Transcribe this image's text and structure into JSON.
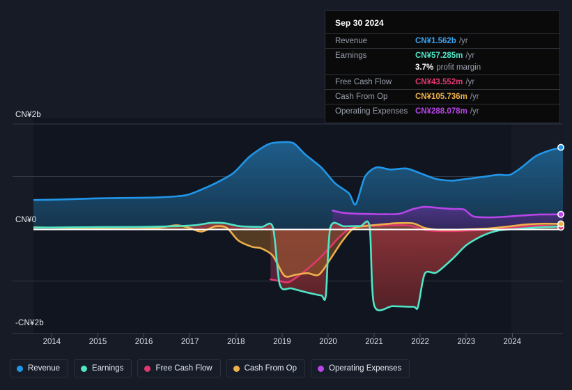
{
  "chart_data": {
    "type": "area",
    "title": "",
    "xlabel": "",
    "ylabel": "",
    "currency": "CN¥",
    "grid": true,
    "legend_position": "bottom",
    "ylim": [
      -2000,
      2000
    ],
    "y_ticks": [
      {
        "value": 2000,
        "label": "CN¥2b"
      },
      {
        "value": 0,
        "label": "CN¥0"
      },
      {
        "value": -2000,
        "label": "-CN¥2b"
      }
    ],
    "x_ticks": [
      "2014",
      "2015",
      "2016",
      "2017",
      "2018",
      "2019",
      "2020",
      "2021",
      "2022",
      "2023",
      "2024"
    ],
    "x_range": [
      2013.6,
      2025.1
    ],
    "forecast_start": "2023.8",
    "series": [
      {
        "name": "Revenue",
        "color": "#2196e8",
        "fill": "#1b4a6b",
        "points": [
          [
            2013.6,
            560
          ],
          [
            2014.2,
            570
          ],
          [
            2014.9,
            590
          ],
          [
            2015.6,
            600
          ],
          [
            2016.3,
            610
          ],
          [
            2016.9,
            650
          ],
          [
            2017.25,
            760
          ],
          [
            2017.6,
            900
          ],
          [
            2017.95,
            1080
          ],
          [
            2018.3,
            1390
          ],
          [
            2018.7,
            1620
          ],
          [
            2019.0,
            1660
          ],
          [
            2019.25,
            1640
          ],
          [
            2019.5,
            1430
          ],
          [
            2019.85,
            1180
          ],
          [
            2020.15,
            880
          ],
          [
            2020.45,
            690
          ],
          [
            2020.6,
            480
          ],
          [
            2020.8,
            1000
          ],
          [
            2021.05,
            1180
          ],
          [
            2021.35,
            1140
          ],
          [
            2021.7,
            1160
          ],
          [
            2022.0,
            1070
          ],
          [
            2022.35,
            960
          ],
          [
            2022.7,
            930
          ],
          [
            2023.0,
            960
          ],
          [
            2023.35,
            1000
          ],
          [
            2023.7,
            1040
          ],
          [
            2023.95,
            1040
          ],
          [
            2024.2,
            1180
          ],
          [
            2024.5,
            1390
          ],
          [
            2024.8,
            1500
          ],
          [
            2025.1,
            1562
          ]
        ],
        "end_value": 1562,
        "end_marker": true
      },
      {
        "name": "Earnings",
        "color": "#4fe6c8",
        "fill": "#7a2530",
        "points": [
          [
            2013.6,
            35
          ],
          [
            2014.4,
            40
          ],
          [
            2015.1,
            45
          ],
          [
            2015.9,
            48
          ],
          [
            2016.6,
            60
          ],
          [
            2017.1,
            80
          ],
          [
            2017.45,
            125
          ],
          [
            2017.75,
            120
          ],
          [
            2018.1,
            60
          ],
          [
            2018.55,
            48
          ],
          [
            2018.8,
            45
          ],
          [
            2018.95,
            -1050
          ],
          [
            2019.2,
            -1120
          ],
          [
            2019.55,
            -1200
          ],
          [
            2019.85,
            -1255
          ],
          [
            2019.95,
            -1260
          ],
          [
            2020.05,
            40
          ],
          [
            2020.35,
            60
          ],
          [
            2020.7,
            65
          ],
          [
            2020.9,
            60
          ],
          [
            2021.0,
            -1440
          ],
          [
            2021.4,
            -1460
          ],
          [
            2021.85,
            -1470
          ],
          [
            2021.95,
            -1475
          ],
          [
            2022.1,
            -840
          ],
          [
            2022.35,
            -820
          ],
          [
            2022.7,
            -560
          ],
          [
            2023.0,
            -300
          ],
          [
            2023.35,
            -120
          ],
          [
            2023.7,
            -20
          ],
          [
            2024.1,
            10
          ],
          [
            2024.6,
            40
          ],
          [
            2025.1,
            57.285
          ]
        ],
        "end_value": 57.285,
        "end_marker": true
      },
      {
        "name": "Free Cash Flow",
        "color": "#e0386e",
        "fill": "#8c3050",
        "points": [
          [
            2018.75,
            -950
          ],
          [
            2018.95,
            -980
          ],
          [
            2019.15,
            -1000
          ],
          [
            2019.45,
            -820
          ],
          [
            2019.75,
            -600
          ],
          [
            2020.0,
            -380
          ],
          [
            2020.25,
            -140
          ],
          [
            2020.5,
            30
          ],
          [
            2020.8,
            60
          ],
          [
            2021.1,
            70
          ],
          [
            2021.45,
            80
          ],
          [
            2021.8,
            70
          ],
          [
            2022.1,
            -10
          ],
          [
            2022.4,
            -30
          ],
          [
            2022.8,
            -30
          ],
          [
            2023.1,
            -20
          ],
          [
            2023.5,
            0
          ],
          [
            2023.9,
            25
          ],
          [
            2024.3,
            60
          ],
          [
            2024.7,
            70
          ],
          [
            2025.1,
            43.552
          ]
        ],
        "end_value": 43.552,
        "end_marker": true
      },
      {
        "name": "Cash From Op",
        "color": "#eeb04a",
        "fill": "#8a5a26",
        "points": [
          [
            2013.6,
            40
          ],
          [
            2014.4,
            30
          ],
          [
            2015.1,
            15
          ],
          [
            2015.8,
            10
          ],
          [
            2016.3,
            30
          ],
          [
            2016.7,
            80
          ],
          [
            2016.95,
            40
          ],
          [
            2017.25,
            -40
          ],
          [
            2017.55,
            60
          ],
          [
            2017.8,
            30
          ],
          [
            2018.05,
            -210
          ],
          [
            2018.35,
            -330
          ],
          [
            2018.55,
            -360
          ],
          [
            2018.8,
            -500
          ],
          [
            2019.05,
            -880
          ],
          [
            2019.3,
            -860
          ],
          [
            2019.55,
            -830
          ],
          [
            2019.8,
            -860
          ],
          [
            2020.05,
            -560
          ],
          [
            2020.3,
            -230
          ],
          [
            2020.55,
            20
          ],
          [
            2020.85,
            70
          ],
          [
            2021.15,
            95
          ],
          [
            2021.5,
            120
          ],
          [
            2021.85,
            115
          ],
          [
            2022.1,
            30
          ],
          [
            2022.4,
            -5
          ],
          [
            2022.8,
            -5
          ],
          [
            2023.1,
            5
          ],
          [
            2023.5,
            20
          ],
          [
            2023.9,
            55
          ],
          [
            2024.3,
            95
          ],
          [
            2024.7,
            110
          ],
          [
            2025.1,
            105.736
          ]
        ],
        "end_value": 105.736,
        "end_marker": true
      },
      {
        "name": "Operating Expenses",
        "color": "#b845e8",
        "fill": "#4a2a70",
        "points": [
          [
            2020.1,
            360
          ],
          [
            2020.3,
            320
          ],
          [
            2020.6,
            300
          ],
          [
            2020.9,
            295
          ],
          [
            2021.2,
            290
          ],
          [
            2021.55,
            300
          ],
          [
            2021.85,
            390
          ],
          [
            2022.1,
            430
          ],
          [
            2022.4,
            410
          ],
          [
            2022.7,
            390
          ],
          [
            2022.95,
            380
          ],
          [
            2023.15,
            250
          ],
          [
            2023.45,
            230
          ],
          [
            2023.8,
            240
          ],
          [
            2024.2,
            265
          ],
          [
            2024.6,
            285
          ],
          [
            2025.1,
            288.078
          ]
        ],
        "end_value": 288.078,
        "end_marker": true
      }
    ]
  },
  "tooltip": {
    "date": "Sep 30 2024",
    "rows": [
      {
        "label": "Revenue",
        "value": "CN¥1.562b",
        "unit": "/yr",
        "color": "#3ba3f0"
      },
      {
        "label": "Earnings",
        "value": "CN¥57.285m",
        "unit": "/yr",
        "color": "#4fe6c8"
      },
      {
        "label": "Free Cash Flow",
        "value": "CN¥43.552m",
        "unit": "/yr",
        "color": "#e0386e"
      },
      {
        "label": "Cash From Op",
        "value": "CN¥105.736m",
        "unit": "/yr",
        "color": "#eeb04a"
      },
      {
        "label": "Operating Expenses",
        "value": "CN¥288.078m",
        "unit": "/yr",
        "color": "#b845e8"
      }
    ],
    "margin_value": "3.7%",
    "margin_label": "profit margin"
  },
  "legend": {
    "items": [
      {
        "label": "Revenue",
        "color": "#2196e8"
      },
      {
        "label": "Earnings",
        "color": "#4fe6c8"
      },
      {
        "label": "Free Cash Flow",
        "color": "#e0386e"
      },
      {
        "label": "Cash From Op",
        "color": "#eeb04a"
      },
      {
        "label": "Operating Expenses",
        "color": "#b845e8"
      }
    ]
  }
}
